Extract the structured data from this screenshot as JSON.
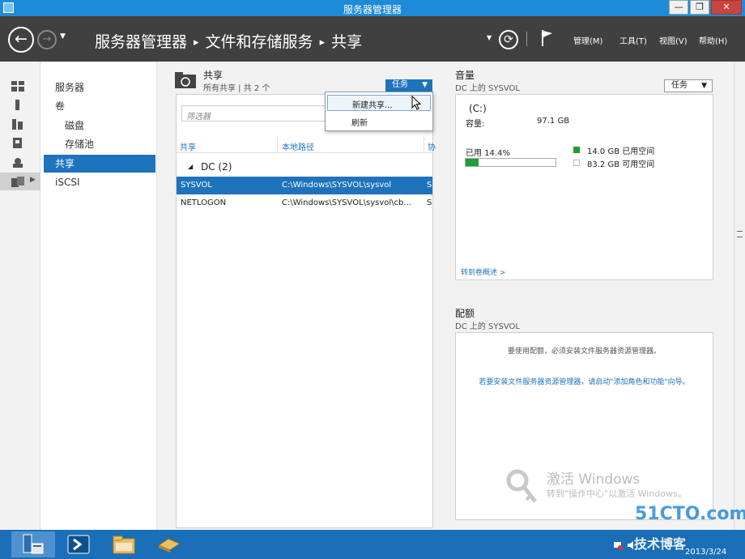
{
  "window": {
    "title": "服务器管理器",
    "minimize": "—",
    "restore": "❐",
    "close": "✕"
  },
  "header": {
    "breadcrumb": [
      "服务器管理器",
      "文件和存储服务",
      "共享"
    ],
    "sep": "▸",
    "menus": [
      "管理(M)",
      "工具(T)",
      "视图(V)",
      "帮助(H)"
    ]
  },
  "nav": {
    "items": [
      "服务器",
      "卷",
      "磁盘",
      "存储池",
      "共享",
      "iSCSI"
    ]
  },
  "shares": {
    "title": "共享",
    "subtitle": "所有共享 | 共 2 个",
    "tasks_label": "任务",
    "filter_placeholder": "筛选器",
    "columns": [
      "共享",
      "本地路径",
      "协"
    ],
    "group": "DC (2)",
    "rows": [
      {
        "name": "SYSVOL",
        "path": "C:\\Windows\\SYSVOL\\sysvol",
        "proto": "S"
      },
      {
        "name": "NETLOGON",
        "path": "C:\\Windows\\SYSVOL\\sysvol\\cb...",
        "proto": "S"
      }
    ],
    "menu": [
      "新建共享...",
      "刷新"
    ]
  },
  "volume": {
    "title": "音量",
    "subtitle": "DC 上的 SYSVOL",
    "tasks_label": "任务",
    "drive": "(C:)",
    "capacity_label": "容量:",
    "capacity_value": "97.1 GB",
    "used_label": "已用 14.4%",
    "used_fraction": 0.144,
    "used_space": "14.0 GB 已用空间",
    "free_space": "83.2 GB 可用空间",
    "link": "转到卷概述 >",
    "used_color": "#1f9e35"
  },
  "quota": {
    "title": "配额",
    "subtitle": "DC 上的 SYSVOL",
    "msg1": "要使用配额，必须安装文件服务器资源管理器。",
    "msg2": "若要安装文件服务器资源管理器，请启动\"添加角色和功能\"向导。"
  },
  "watermark": {
    "line1": "激活 Windows",
    "line2": "转到\"操作中心\"以激活 Windows。"
  },
  "tray": {
    "line1": "51CTO.com",
    "line2": "技术博客",
    "date": "2013/3/24"
  }
}
